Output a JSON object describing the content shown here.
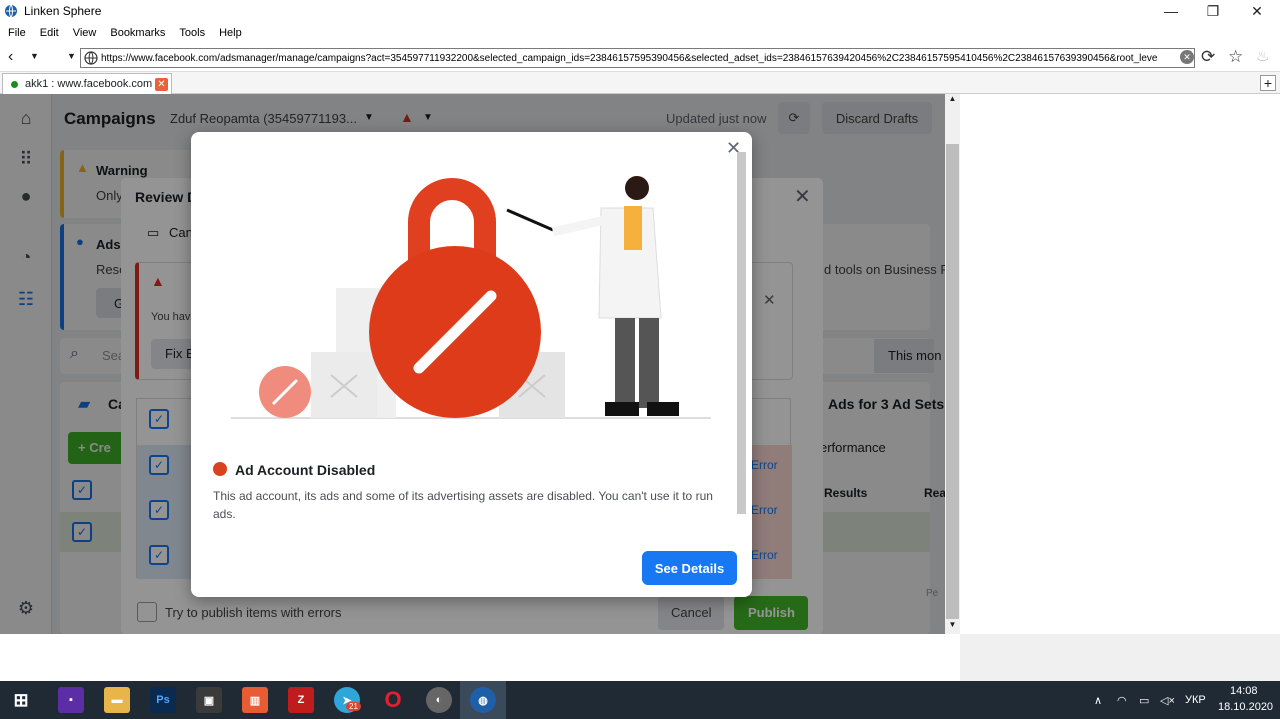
{
  "browser": {
    "title": "Linken Sphere",
    "menu": [
      "File",
      "Edit",
      "View",
      "Bookmarks",
      "Tools",
      "Help"
    ],
    "url": "https://www.facebook.com/adsmanager/manage/campaigns?act=354597711932200&selected_campaign_ids=23846157595390456&selected_adset_ids=23846157639420456%2C23846157595410456%2C23846157639390456&root_leve",
    "tab_label": "akk1 : www.facebook.com"
  },
  "app": {
    "page_title": "Campaigns",
    "account": "Zduf Reopamta (35459771193...",
    "updated": "Updated just now",
    "discard": "Discard Drafts",
    "warning_title": "Warning",
    "warning_text": "Only",
    "ads_title": "Ads",
    "ads_text": "Rese",
    "ads_btn": "G",
    "business_text": "d tools on Business F",
    "search_placeholder": "Sea",
    "this_month": "This mon",
    "campaigns_tab": "Ca",
    "create_btn": "+ Cre",
    "ads_for": "Ads for 3 Ad Sets",
    "performance": "erformance",
    "col_results": "Results",
    "col_reach": "Rea",
    "dash": "—",
    "per": "Pe"
  },
  "review": {
    "title": "Review D",
    "cam": "Can",
    "you_have": "You hav",
    "fix": "Fix E",
    "errors": [
      "Error",
      "Error",
      "Error"
    ],
    "try_publish": "Try to publish items with errors",
    "cancel": "Cancel",
    "publish": "Publish"
  },
  "modal": {
    "heading": "Ad Account Disabled",
    "body": "This ad account, its ads and some of its advertising assets are disabled. You can't use it to run ads.",
    "button": "See Details",
    "accent": "#d9421f",
    "button_color": "#1877f2"
  },
  "taskbar": {
    "lang": "УКР",
    "time": "14:08",
    "date": "18.10.2020",
    "telegram_badge": "21"
  }
}
